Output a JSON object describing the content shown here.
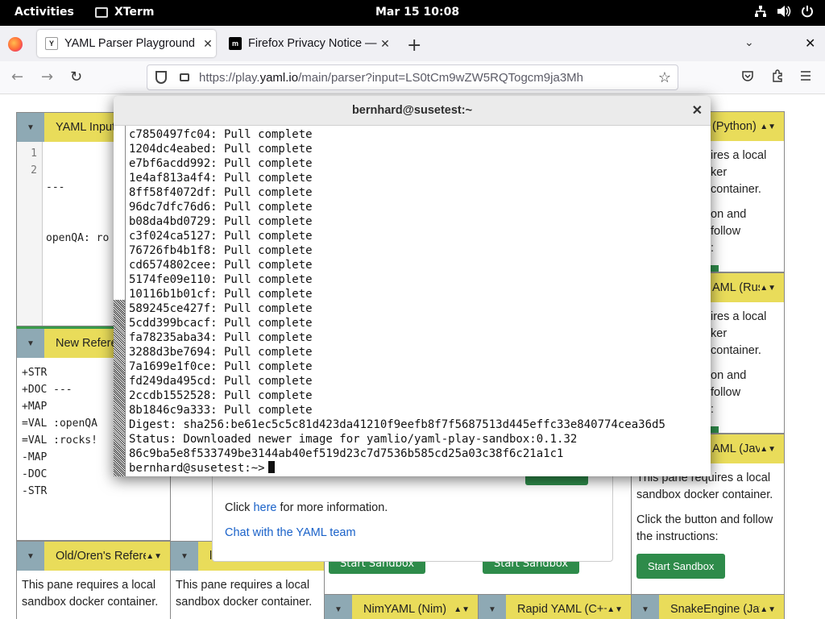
{
  "topbar": {
    "activities": "Activities",
    "app_name": "XTerm",
    "clock": "Mar 15  10:08",
    "tray_icons": [
      "network-icon",
      "volume-icon",
      "power-icon"
    ]
  },
  "browser": {
    "tabs": [
      {
        "title": "YAML Parser Playground",
        "favicon": "yaml-favicon",
        "active": true
      },
      {
        "title": "Firefox Privacy Notice — M",
        "favicon": "mozilla-favicon",
        "active": false
      }
    ],
    "url_prefix": "https://play.",
    "url_domain": "yaml.io",
    "url_rest": "/main/parser?input=LS0tCm9wZW5RQTogcm9ja3Mh"
  },
  "page": {
    "panes": {
      "yaml_input": {
        "title": "YAML Input",
        "line_numbers": [
          "1",
          "2"
        ],
        "lines": [
          "---",
          "openQA: ro"
        ]
      },
      "new_reference": {
        "title": "New Referen",
        "events": [
          "+STR",
          "+DOC ---",
          "+MAP",
          "=VAL :openQA",
          "=VAL :rocks!",
          "-MAP",
          "-DOC",
          "-STR"
        ]
      },
      "old_oren": {
        "title": "Old/Oren's Referer",
        "text": "This pane requires a local sandbox docker container."
      },
      "pane_b": {
        "title": "l",
        "text": "This pane requires a local sandbox docker container."
      },
      "python": {
        "title": "(Python)",
        "line1": "ires a local",
        "line2": "ker container.",
        "line3": "on and follow",
        "line4": ":"
      },
      "rust": {
        "title": "AML (Rust",
        "line1": "ires a local",
        "line2": "ker container.",
        "line3": "on and follow",
        "line4": ":"
      },
      "java": {
        "title": "AML (Java",
        "text1": "This pane requires a local sandbox docker container.",
        "text2": "Click the button and follow the instructions:",
        "button": "Start Sandbox"
      },
      "nim": {
        "title": "NimYAML (Nim)",
        "button": "Start Sandbox"
      },
      "rapid": {
        "title": "Rapid YAML (C++)",
        "button": "Start Sandbox"
      },
      "snake": {
        "title": "SnakeEngine (Java"
      }
    },
    "modal": {
      "click": "Click ",
      "here": "here",
      "more_info": " for more information.",
      "chat": "Chat with the YAML team"
    }
  },
  "xterm": {
    "title": "bernhard@susetest:~",
    "lines": [
      "c7850497fc04: Pull complete",
      "1204dc4eabed: Pull complete",
      "e7bf6acdd992: Pull complete",
      "1e4af813a4f4: Pull complete",
      "8ff58f4072df: Pull complete",
      "96dc7dfc76d6: Pull complete",
      "b08da4bd0729: Pull complete",
      "c3f024ca5127: Pull complete",
      "76726fb4b1f8: Pull complete",
      "cd6574802cee: Pull complete",
      "5174fe09e110: Pull complete",
      "10116b1b01cf: Pull complete",
      "589245ce427f: Pull complete",
      "5cdd399bcacf: Pull complete",
      "fa78235aba34: Pull complete",
      "3288d3be7694: Pull complete",
      "7a1699e1f0ce: Pull complete",
      "fd249da495cd: Pull complete",
      "2ccdb1552528: Pull complete",
      "8b1846c9a333: Pull complete",
      "Digest: sha256:be61ec5c5c81d423da41210f9eefb8f7f5687513d445effc33e840774cea36d5",
      "Status: Downloaded newer image for yamlio/yaml-play-sandbox:0.1.32",
      "86c9ba5e8f533749be3144ab40ef519d23c7d7536b585cd25a03c38f6c21a1c1"
    ],
    "prompt": "bernhard@susetest:~>"
  }
}
